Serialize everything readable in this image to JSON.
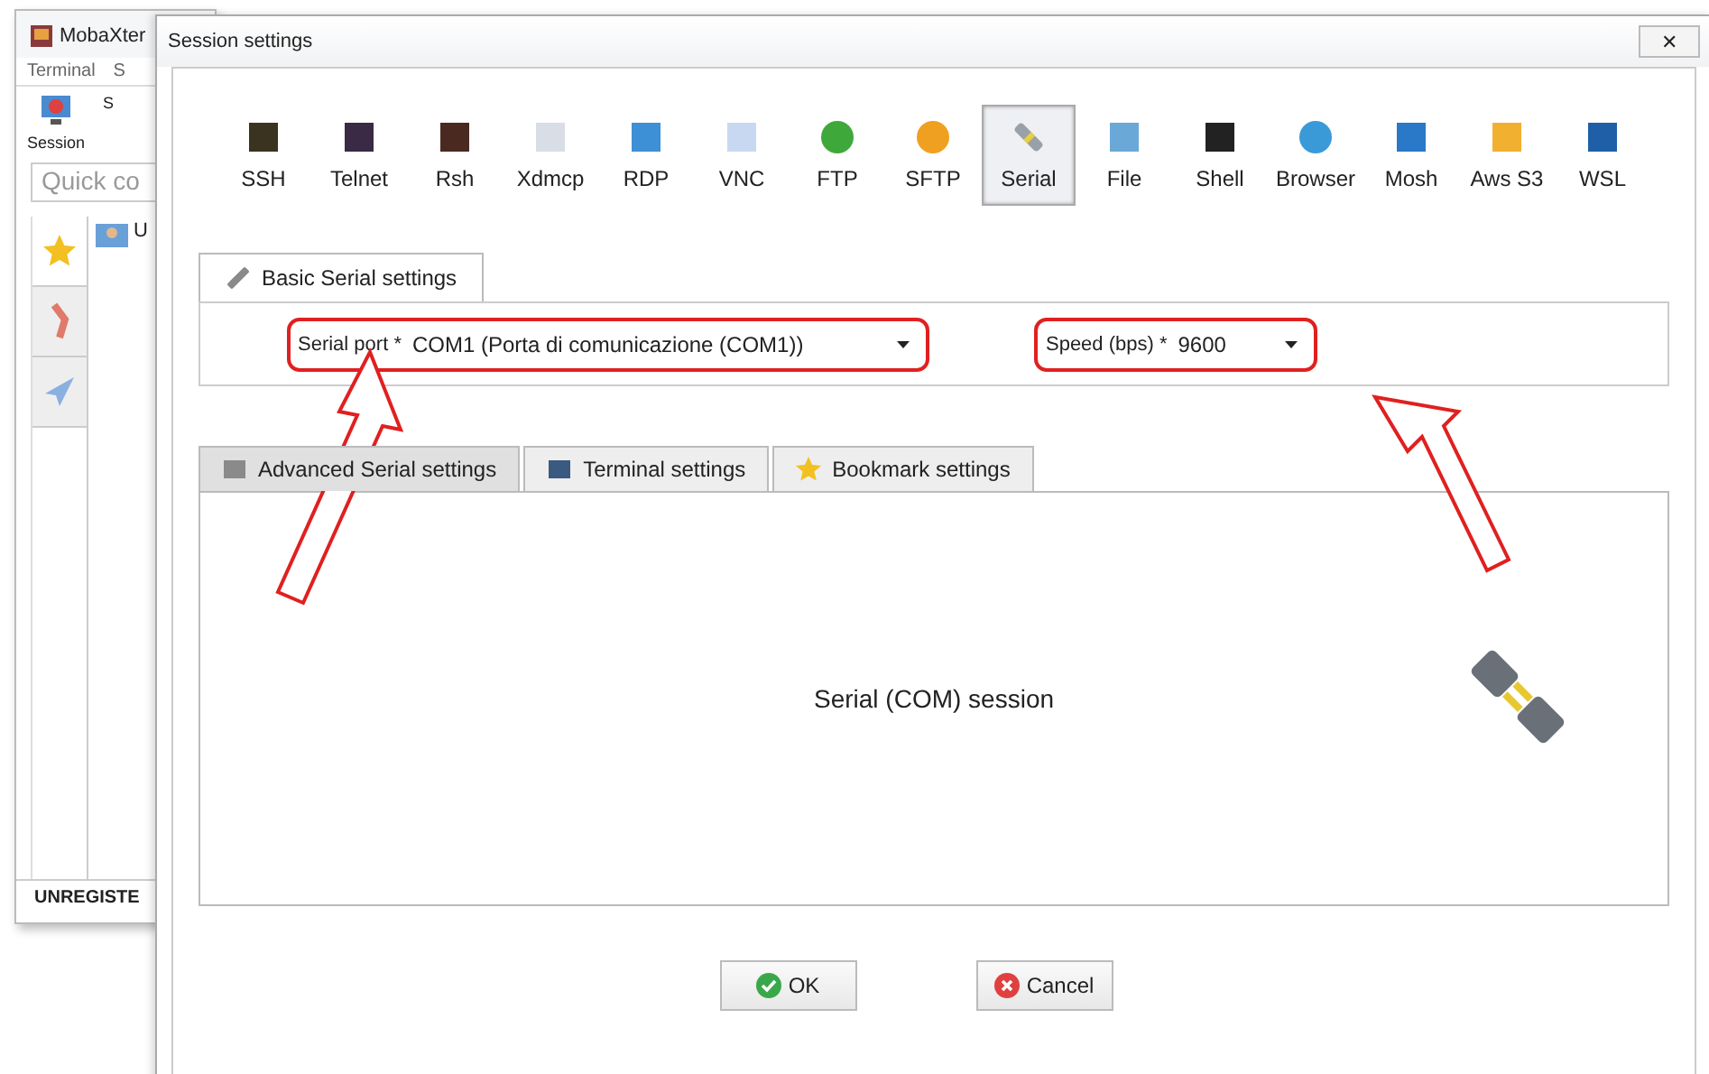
{
  "main_window": {
    "title": "MobaXter",
    "menu": [
      "Terminal",
      "S"
    ],
    "toolbar": [
      "Session",
      "S"
    ],
    "quick_connect": {
      "placeholder": "Quick co"
    },
    "sidebar_tabs": [
      {
        "selected": true
      },
      {
        "selected": false
      },
      {
        "selected": false
      }
    ],
    "tree_item": "U",
    "status_bar": "UNREGISTE"
  },
  "dialog": {
    "title": "Session settings",
    "close": "✕"
  },
  "session_types": [
    {
      "label": "SSH",
      "selected": false
    },
    {
      "label": "Telnet",
      "selected": false
    },
    {
      "label": "Rsh",
      "selected": false
    },
    {
      "label": "Xdmcp",
      "selected": false
    },
    {
      "label": "RDP",
      "selected": false
    },
    {
      "label": "VNC",
      "selected": false
    },
    {
      "label": "FTP",
      "selected": false
    },
    {
      "label": "SFTP",
      "selected": false
    },
    {
      "label": "Serial",
      "selected": true
    },
    {
      "label": "File",
      "selected": false
    },
    {
      "label": "Shell",
      "selected": false
    },
    {
      "label": "Browser",
      "selected": false
    },
    {
      "label": "Mosh",
      "selected": false
    },
    {
      "label": "Aws S3",
      "selected": false
    },
    {
      "label": "WSL",
      "selected": false
    }
  ],
  "basic_tab": {
    "label": "Basic Serial settings"
  },
  "serial_port": {
    "label": "Serial port *",
    "value": "COM1  (Porta di comunicazione (COM1))"
  },
  "speed": {
    "label": "Speed (bps) *",
    "value": "9600"
  },
  "tabs": [
    {
      "label": "Advanced Serial settings",
      "selected": true
    },
    {
      "label": "Terminal settings",
      "selected": false
    },
    {
      "label": "Bookmark settings",
      "selected": false
    }
  ],
  "panel_text": "Serial (COM) session",
  "buttons": [
    "OK",
    "Cancel"
  ]
}
